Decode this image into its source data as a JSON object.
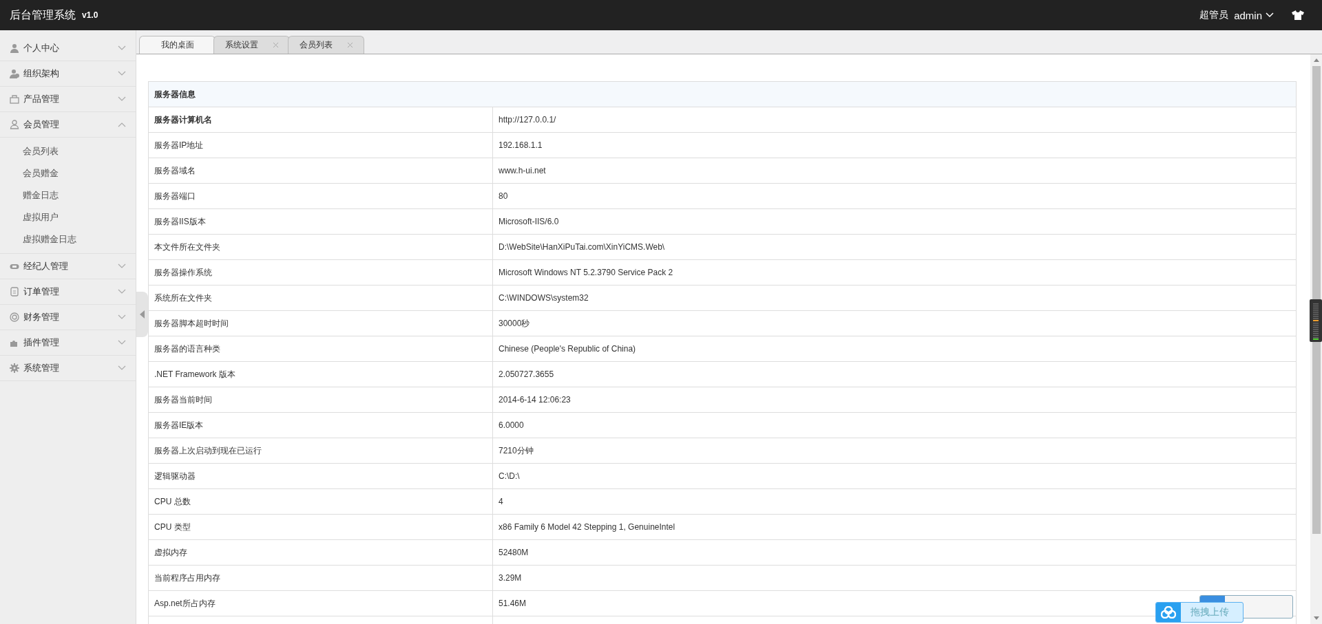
{
  "header": {
    "title": "后台管理系统",
    "version": "v1.0",
    "role": "超管员",
    "user": "admin"
  },
  "sidebar": {
    "items": [
      {
        "label": "个人中心",
        "expanded": false
      },
      {
        "label": "组织架构",
        "expanded": false
      },
      {
        "label": "产品管理",
        "expanded": false
      },
      {
        "label": "会员管理",
        "expanded": true,
        "children": [
          {
            "label": "会员列表"
          },
          {
            "label": "会员赠金"
          },
          {
            "label": "赠金日志"
          },
          {
            "label": "虚拟用户"
          },
          {
            "label": "虚拟赠金日志"
          }
        ]
      },
      {
        "label": "经纪人管理",
        "expanded": false
      },
      {
        "label": "订单管理",
        "expanded": false
      },
      {
        "label": "财务管理",
        "expanded": false
      },
      {
        "label": "插件管理",
        "expanded": false
      },
      {
        "label": "系统管理",
        "expanded": false
      }
    ]
  },
  "tabs": [
    {
      "label": "我的桌面",
      "selected": true,
      "closable": false
    },
    {
      "label": "系统设置",
      "selected": false,
      "closable": true
    },
    {
      "label": "会员列表",
      "selected": false,
      "closable": true
    }
  ],
  "table": {
    "title": "服务器信息",
    "rows": [
      {
        "label": "服务器计算机名",
        "value": "http://127.0.0.1/",
        "bold": true
      },
      {
        "label": "服务器IP地址",
        "value": "192.168.1.1",
        "bold": false
      },
      {
        "label": "服务器域名",
        "value": "www.h-ui.net",
        "bold": false
      },
      {
        "label": "服务器端口",
        "value": "80",
        "bold": false
      },
      {
        "label": "服务器IIS版本",
        "value": "Microsoft-IIS/6.0",
        "bold": false
      },
      {
        "label": "本文件所在文件夹",
        "value": "D:\\WebSite\\HanXiPuTai.com\\XinYiCMS.Web\\",
        "bold": false
      },
      {
        "label": "服务器操作系统",
        "value": "Microsoft Windows NT 5.2.3790 Service Pack 2",
        "bold": false
      },
      {
        "label": "系统所在文件夹",
        "value": "C:\\WINDOWS\\system32",
        "bold": false
      },
      {
        "label": "服务器脚本超时时间",
        "value": "30000秒",
        "bold": false
      },
      {
        "label": "服务器的语言种类",
        "value": "Chinese (People's Republic of China)",
        "bold": false
      },
      {
        "label": ".NET Framework 版本",
        "value": "2.050727.3655",
        "bold": false
      },
      {
        "label": "服务器当前时间",
        "value": "2014-6-14 12:06:23",
        "bold": false
      },
      {
        "label": "服务器IE版本",
        "value": "6.0000",
        "bold": false
      },
      {
        "label": "服务器上次启动到现在已运行",
        "value": "7210分钟",
        "bold": false
      },
      {
        "label": "逻辑驱动器",
        "value": "C:\\D:\\",
        "bold": false
      },
      {
        "label": "CPU 总数",
        "value": "4",
        "bold": false
      },
      {
        "label": "CPU 类型",
        "value": "x86 Family 6 Model 42 Stepping 1, GenuineIntel",
        "bold": false
      },
      {
        "label": "虚拟内存",
        "value": "52480M",
        "bold": false
      },
      {
        "label": "当前程序占用内存",
        "value": "3.29M",
        "bold": false
      },
      {
        "label": "Asp.net所占内存",
        "value": "51.46M",
        "bold": false
      }
    ]
  },
  "upload_widget": {
    "label": "拖拽上传"
  }
}
